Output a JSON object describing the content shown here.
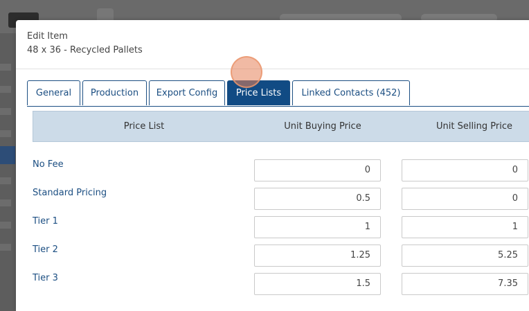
{
  "modal": {
    "title": "Edit Item",
    "subtitle": "48 x 36 - Recycled Pallets"
  },
  "tabs": [
    {
      "label": "General",
      "active": false
    },
    {
      "label": "Production",
      "active": false
    },
    {
      "label": "Export Config",
      "active": false
    },
    {
      "label": "Price Lists",
      "active": true
    },
    {
      "label": "Linked Contacts (452)",
      "active": false
    }
  ],
  "table": {
    "headers": [
      "Price List",
      "Unit Buying Price",
      "Unit Selling Price"
    ],
    "rows": [
      {
        "name": "No Fee",
        "buy": "0",
        "sell": "0"
      },
      {
        "name": "Standard Pricing",
        "buy": "0.5",
        "sell": "0"
      },
      {
        "name": "Tier 1",
        "buy": "1",
        "sell": "1"
      },
      {
        "name": "Tier 2",
        "buy": "1.25",
        "sell": "5.25"
      },
      {
        "name": "Tier 3",
        "buy": "1.5",
        "sell": "7.35"
      }
    ]
  },
  "colors": {
    "accent": "#114b84",
    "header_bg": "#ccdbe8",
    "overlay": "#5d5d5d"
  }
}
